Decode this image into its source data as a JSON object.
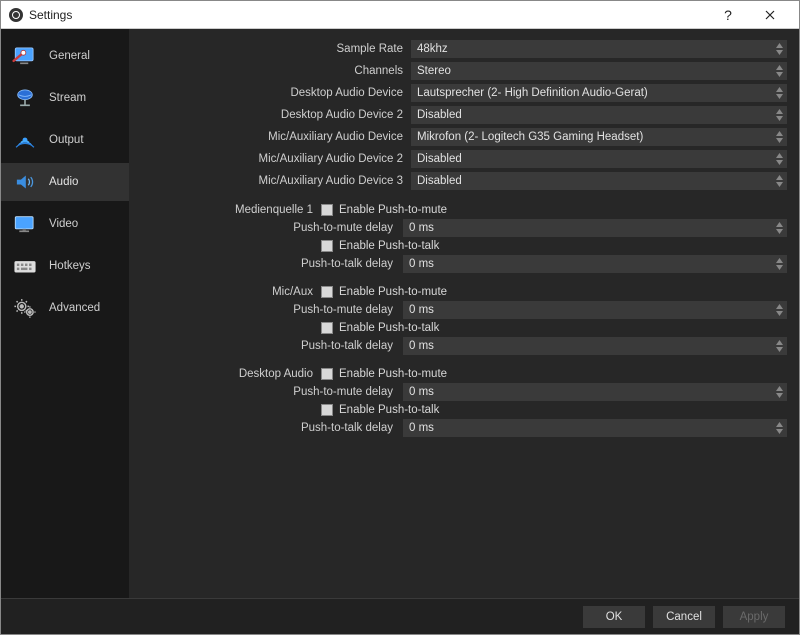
{
  "window": {
    "title": "Settings"
  },
  "sidebar": {
    "items": [
      {
        "label": "General"
      },
      {
        "label": "Stream"
      },
      {
        "label": "Output"
      },
      {
        "label": "Audio"
      },
      {
        "label": "Video"
      },
      {
        "label": "Hotkeys"
      },
      {
        "label": "Advanced"
      }
    ]
  },
  "audio": {
    "sample_rate": {
      "label": "Sample Rate",
      "value": "48khz"
    },
    "channels": {
      "label": "Channels",
      "value": "Stereo"
    },
    "desktop1": {
      "label": "Desktop Audio Device",
      "value": "Lautsprecher (2- High Definition Audio-Gerat)"
    },
    "desktop2": {
      "label": "Desktop Audio Device 2",
      "value": "Disabled"
    },
    "mic1": {
      "label": "Mic/Auxiliary Audio Device",
      "value": "Mikrofon (2- Logitech G35 Gaming Headset)"
    },
    "mic2": {
      "label": "Mic/Auxiliary Audio Device 2",
      "value": "Disabled"
    },
    "mic3": {
      "label": "Mic/Auxiliary Audio Device 3",
      "value": "Disabled"
    }
  },
  "sources": [
    {
      "name": "Medienquelle 1",
      "push_mute_label": "Enable Push-to-mute",
      "push_mute_delay_label": "Push-to-mute delay",
      "push_mute_delay": "0 ms",
      "push_talk_label": "Enable Push-to-talk",
      "push_talk_delay_label": "Push-to-talk delay",
      "push_talk_delay": "0 ms"
    },
    {
      "name": "Mic/Aux",
      "push_mute_label": "Enable Push-to-mute",
      "push_mute_delay_label": "Push-to-mute delay",
      "push_mute_delay": "0 ms",
      "push_talk_label": "Enable Push-to-talk",
      "push_talk_delay_label": "Push-to-talk delay",
      "push_talk_delay": "0 ms"
    },
    {
      "name": "Desktop Audio",
      "push_mute_label": "Enable Push-to-mute",
      "push_mute_delay_label": "Push-to-mute delay",
      "push_mute_delay": "0 ms",
      "push_talk_label": "Enable Push-to-talk",
      "push_talk_delay_label": "Push-to-talk delay",
      "push_talk_delay": "0 ms"
    }
  ],
  "footer": {
    "ok": "OK",
    "cancel": "Cancel",
    "apply": "Apply"
  }
}
